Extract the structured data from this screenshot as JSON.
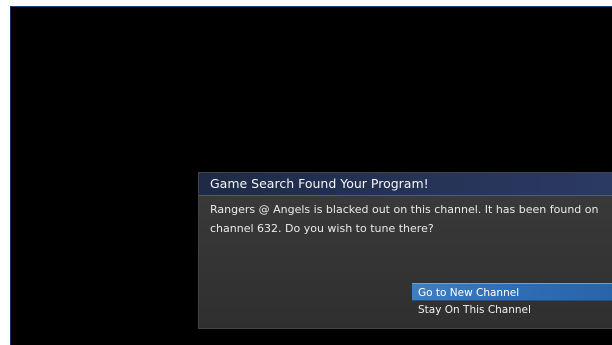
{
  "dialog": {
    "title": "Game Search Found Your Program!",
    "message": "Rangers @ Angels is blacked out on this channel. It has been found on channel 632. Do you wish to tune there?"
  },
  "menu": {
    "items": [
      {
        "label": "Go to New Channel",
        "selected": true
      },
      {
        "label": "Stay On This Channel",
        "selected": false
      }
    ]
  },
  "colors": {
    "screen_background": "#000000",
    "dialog_background": "#353535",
    "header_background": "#263458",
    "selected_item": "#2f6db5"
  }
}
